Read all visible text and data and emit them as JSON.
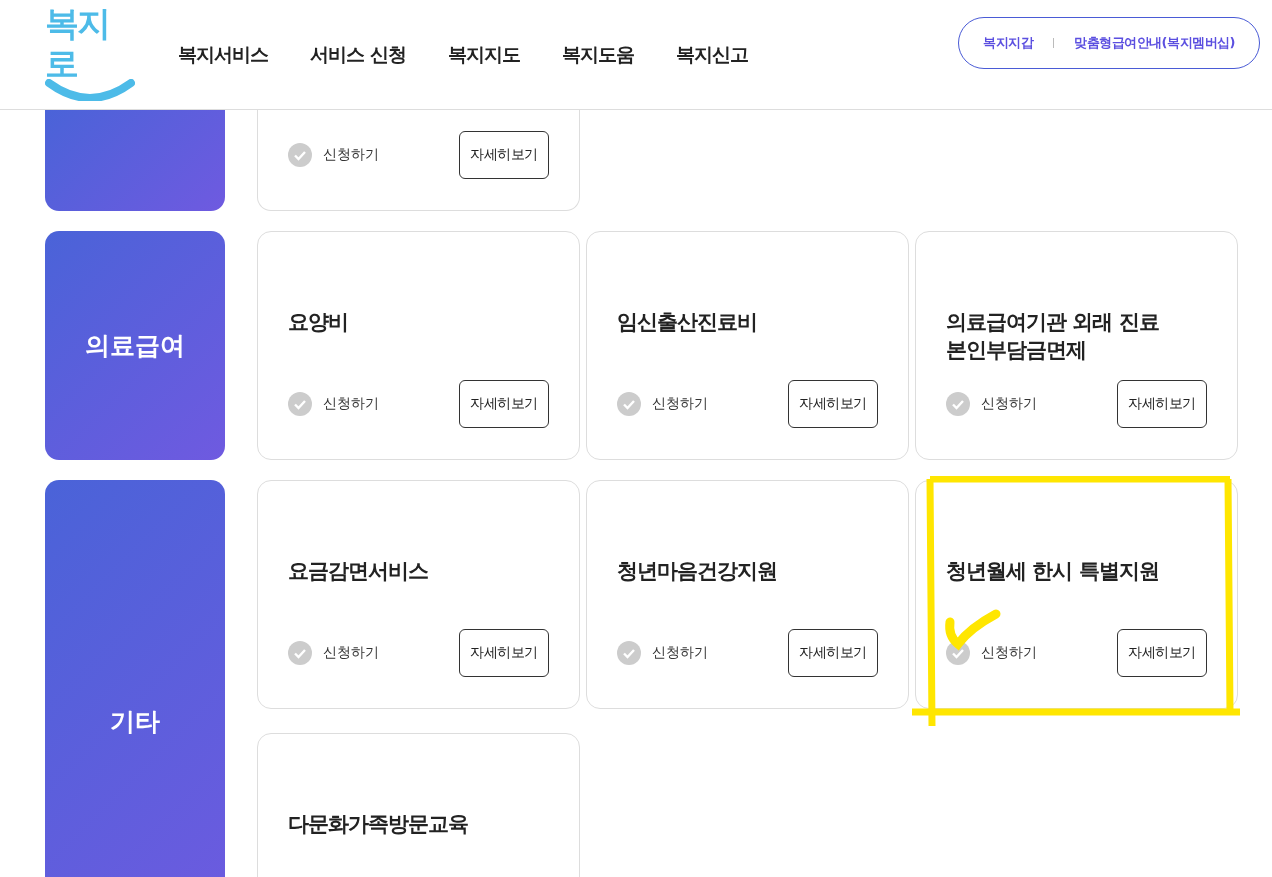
{
  "header": {
    "logo": "복지로",
    "nav": [
      "복지서비스",
      "서비스 신청",
      "복지지도",
      "복지도움",
      "복지신고"
    ],
    "quick_links": [
      "복지지갑",
      "맞춤형급여안내(복지멤버십)"
    ]
  },
  "sections": [
    {
      "cards": [
        {
          "apply": "신청하기",
          "details": "자세히보기"
        }
      ]
    },
    {
      "category": "의료급여",
      "cards": [
        {
          "title": "요양비",
          "apply": "신청하기",
          "details": "자세히보기"
        },
        {
          "title": "임신출산진료비",
          "apply": "신청하기",
          "details": "자세히보기"
        },
        {
          "title": "의료급여기관 외래 진료 본인부담금면제",
          "apply": "신청하기",
          "details": "자세히보기"
        }
      ]
    },
    {
      "category": "기타",
      "cards": [
        {
          "title": "요금감면서비스",
          "apply": "신청하기",
          "details": "자세히보기"
        },
        {
          "title": "청년마음건강지원",
          "apply": "신청하기",
          "details": "자세히보기"
        },
        {
          "title": "청년월세 한시 특별지원",
          "apply": "신청하기",
          "details": "자세히보기"
        },
        {
          "title": "다문화가족방문교육"
        }
      ]
    }
  ]
}
